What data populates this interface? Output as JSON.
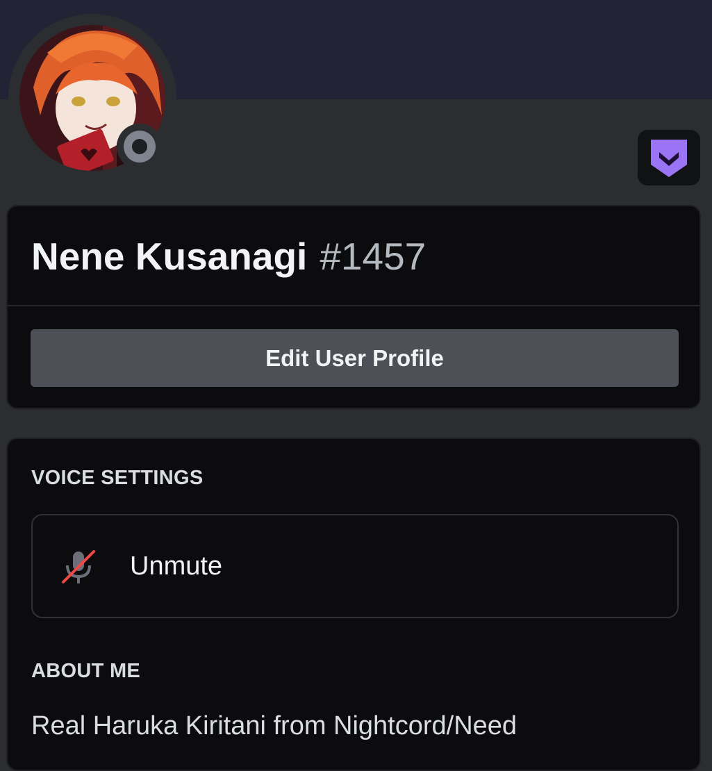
{
  "profile": {
    "display_name": "Nene Kusanagi",
    "discriminator": "#1457",
    "status": "offline",
    "badge_icon": "nitro-badge-icon"
  },
  "actions": {
    "edit_profile_label": "Edit User Profile"
  },
  "voice_settings": {
    "title": "VOICE SETTINGS",
    "unmute_label": "Unmute",
    "icon": "microphone-muted-icon"
  },
  "about": {
    "title": "ABOUT ME",
    "text": "Real Haruka Kiritani from Nightcord/Need"
  },
  "colors": {
    "banner": "#232336",
    "background": "#2b2d31",
    "card": "#0c0c0e",
    "badge_purple": "#9a74f5",
    "mute_red": "#f04747"
  }
}
